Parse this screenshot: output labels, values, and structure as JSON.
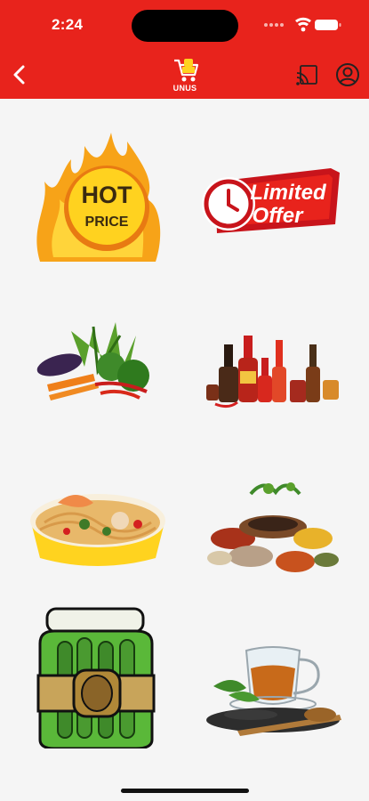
{
  "status_bar": {
    "time": "2:24"
  },
  "header": {
    "logo_text": "UNUS",
    "accent_color": "#e8231c"
  },
  "categories": [
    {
      "name": "hot-price",
      "text_line1": "HOT",
      "text_line2": "PRICE"
    },
    {
      "name": "limited-offer",
      "text_line1": "Limited",
      "text_line2": "Offer"
    },
    {
      "name": "vegetables"
    },
    {
      "name": "sauces"
    },
    {
      "name": "noodles"
    },
    {
      "name": "spices"
    },
    {
      "name": "pickles"
    },
    {
      "name": "tea"
    }
  ],
  "icons": {
    "back": "chevron-left-icon",
    "cast": "cast-icon",
    "profile": "user-circle-icon",
    "logo": "shopping-cart-logo"
  }
}
